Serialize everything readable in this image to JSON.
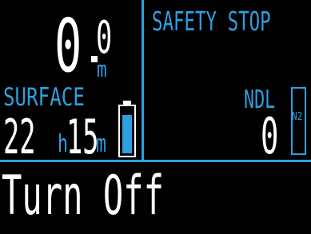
{
  "depth": {
    "integer": "0",
    "decimal": "0",
    "unit": "m"
  },
  "surface": {
    "label": "SURFACE",
    "hours": "22",
    "hours_unit": "h",
    "minutes": "15",
    "minutes_unit": "m"
  },
  "battery": {
    "icon": "battery-icon",
    "level_percent": 85,
    "fill_color": "#2da0e0"
  },
  "safety_stop": {
    "label": "SAFETY STOP"
  },
  "ndl": {
    "label": "NDL",
    "value": "0"
  },
  "n2_gauge": {
    "label": "N2",
    "level_percent": 0
  },
  "menu": {
    "action_label": "Turn Off"
  },
  "colors": {
    "accent": "#2da0e0",
    "text": "#ffffff",
    "background": "#000000"
  }
}
